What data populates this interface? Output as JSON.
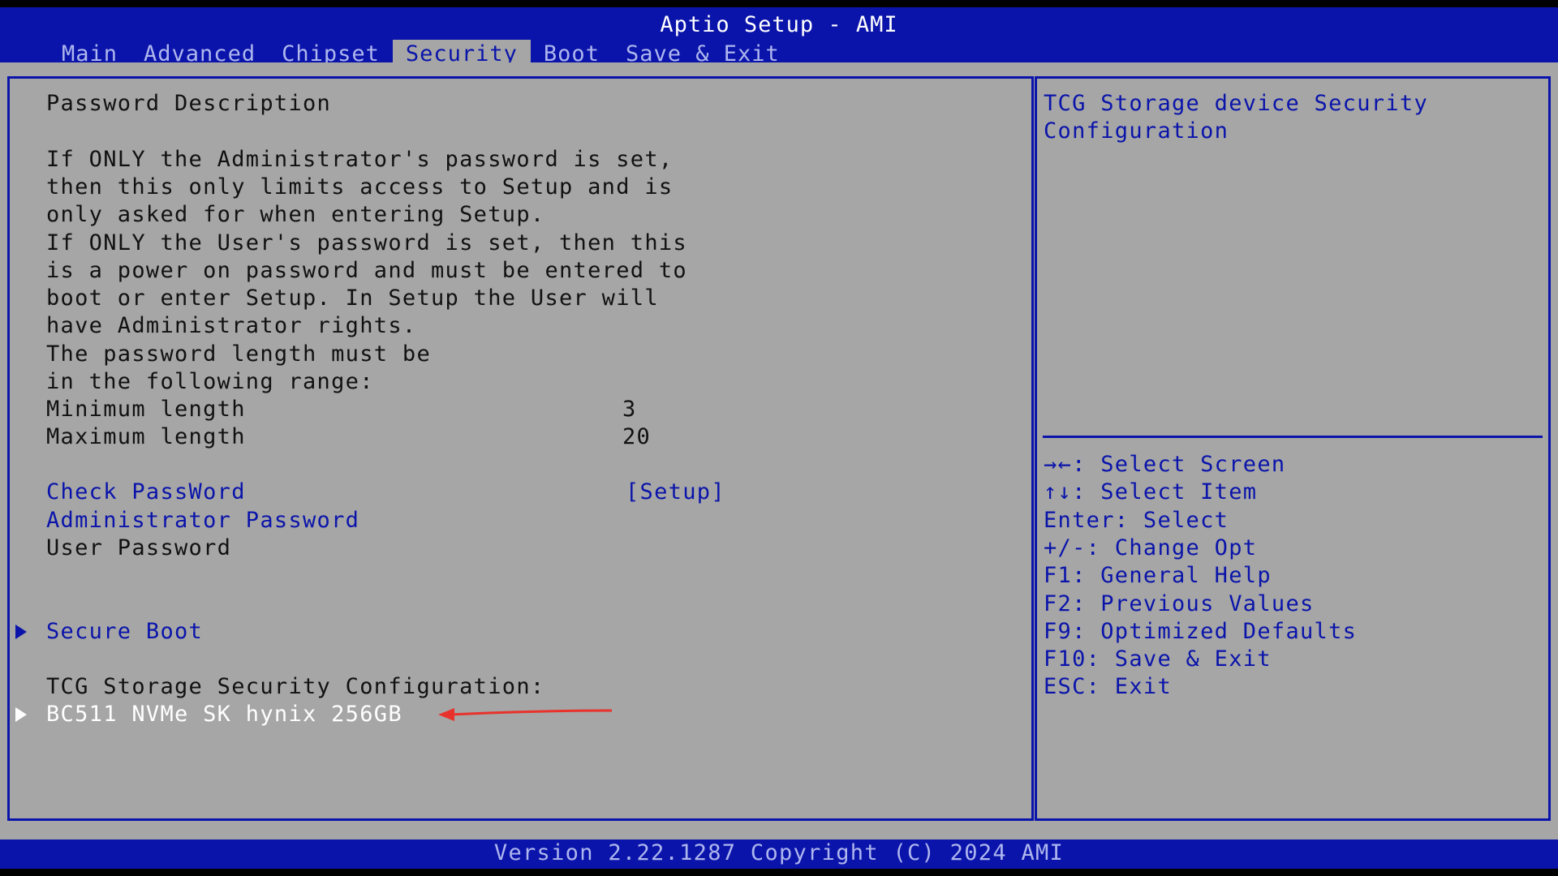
{
  "title": "Aptio Setup - AMI",
  "tabs": [
    "Main",
    "Advanced",
    "Chipset",
    "Security",
    "Boot",
    "Save & Exit"
  ],
  "active_tab": "Security",
  "left": {
    "heading": "Password Description",
    "desc_lines": [
      "If ONLY the Administrator's password is set,",
      "then this only limits access to Setup and is",
      "only asked for when entering Setup.",
      "If ONLY the User's password is set, then this",
      "is a power on password and must be entered to",
      "boot or enter Setup. In Setup the User will",
      "have Administrator rights.",
      "The password length must be",
      "in the following range:"
    ],
    "min_label": "Minimum length",
    "min_value": "3",
    "max_label": "Maximum length",
    "max_value": "20",
    "check_label": "Check PassWord",
    "check_value": "[Setup]",
    "admin_label": "Administrator Password",
    "user_label": "User Password",
    "secure_boot": "Secure Boot",
    "tcg_heading": "TCG Storage Security Configuration:",
    "device": "BC511 NVMe SK hynix 256GB"
  },
  "help": {
    "line1": "TCG Storage device Security",
    "line2": "Configuration"
  },
  "keys": [
    "→←: Select Screen",
    "↑↓: Select Item",
    "Enter: Select",
    "+/-: Change Opt",
    "F1: General Help",
    "F2: Previous Values",
    "F9: Optimized Defaults",
    "F10: Save & Exit",
    "ESC: Exit"
  ],
  "footer": "Version 2.22.1287 Copyright (C) 2024 AMI",
  "colors": {
    "blue": "#0a14aa",
    "gray": "#a6a6a6",
    "annotation": "#e8322b"
  }
}
